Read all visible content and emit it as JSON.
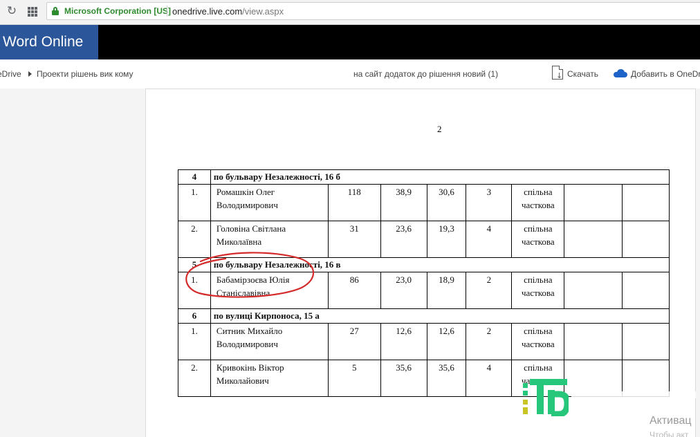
{
  "browser": {
    "cert_label": "Microsoft Corporation [US]",
    "url_domain": "onedrive.live.com",
    "url_path": "/view.aspx"
  },
  "app": {
    "brand": "Word Online"
  },
  "commandbar": {
    "breadcrumb_root": "eDrive",
    "breadcrumb_folder": "Проекти рішень вик кому",
    "document_title": "на сайт додаток до рішення новий (1)",
    "download_label": "Скачать",
    "add_label": "Добавить в OneDr"
  },
  "document": {
    "page_number": "2",
    "sections": [
      {
        "num": "4",
        "address": "по бульвару Незалежності, 16 б",
        "rows": [
          {
            "num": "1.",
            "name_line1": "Ромашкін Олег",
            "name_line2": "Володимирович",
            "c1": "118",
            "c2": "38,9",
            "c3": "30,6",
            "c4": "3",
            "type_line1": "спільна",
            "type_line2": "часткова",
            "c5": "",
            "c6": ""
          },
          {
            "num": "2.",
            "name_line1": "Головіна  Світлана",
            "name_line2": "Миколаївна",
            "c1": "31",
            "c2": "23,6",
            "c3": "19,3",
            "c4": "4",
            "type_line1": "спільна",
            "type_line2": "часткова",
            "c5": "",
            "c6": ""
          }
        ]
      },
      {
        "num": "5",
        "address": "по бульвару Незалежності, 16 в",
        "rows": [
          {
            "num": "1.",
            "name_line1": "Бабамірзоєва Юлія",
            "name_line2": "Станіславівна",
            "c1": "86",
            "c2": "23,0",
            "c3": "18,9",
            "c4": "2",
            "type_line1": "спільна",
            "type_line2": "часткова",
            "c5": "",
            "c6": ""
          }
        ]
      },
      {
        "num": "6",
        "address": "по вулиці Кирпоноса, 15 а",
        "rows": [
          {
            "num": "1.",
            "name_line1": "Ситник  Михайло",
            "name_line2": "Володимирович",
            "c1": "27",
            "c2": "12,6",
            "c3": "12,6",
            "c4": "2",
            "type_line1": "спільна",
            "type_line2": "часткова",
            "c5": "",
            "c6": ""
          },
          {
            "num": "2.",
            "name_line1": "Кривокінь  Віктор",
            "name_line2": "Миколайович",
            "c1": "5",
            "c2": "35,6",
            "c3": "35,6",
            "c4": "4",
            "type_line1": "спільна",
            "type_line2": "часткова",
            "c5": "",
            "c6": ""
          }
        ]
      }
    ]
  },
  "overlay": {
    "activation_text": "Активац",
    "activation_subtext": "Чтобы акт",
    "circle_color": "#d42a2a",
    "logo_color_green": "#26c77a",
    "logo_color_yellow": "#c7c423"
  }
}
